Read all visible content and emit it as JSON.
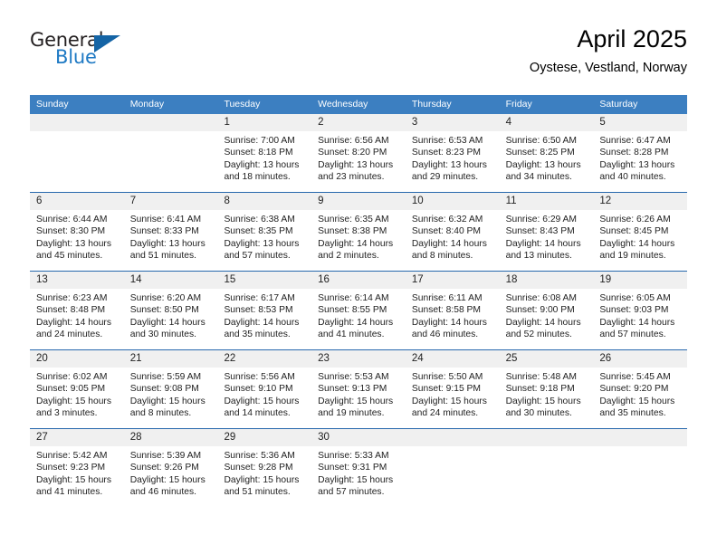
{
  "brand": {
    "name_part1": "General",
    "name_part2": "Blue",
    "accent_color": "#1464a5"
  },
  "header": {
    "title": "April 2025",
    "subtitle": "Oystese, Vestland, Norway"
  },
  "calendar": {
    "header_bg": "#3c7fc1",
    "row_rule_color": "#2768ad",
    "daynum_bg": "#f0f0f0",
    "weekdays": [
      "Sunday",
      "Monday",
      "Tuesday",
      "Wednesday",
      "Thursday",
      "Friday",
      "Saturday"
    ],
    "weeks": [
      [
        {
          "day": "",
          "lines": []
        },
        {
          "day": "",
          "lines": []
        },
        {
          "day": "1",
          "lines": [
            "Sunrise: 7:00 AM",
            "Sunset: 8:18 PM",
            "Daylight: 13 hours",
            "and 18 minutes."
          ]
        },
        {
          "day": "2",
          "lines": [
            "Sunrise: 6:56 AM",
            "Sunset: 8:20 PM",
            "Daylight: 13 hours",
            "and 23 minutes."
          ]
        },
        {
          "day": "3",
          "lines": [
            "Sunrise: 6:53 AM",
            "Sunset: 8:23 PM",
            "Daylight: 13 hours",
            "and 29 minutes."
          ]
        },
        {
          "day": "4",
          "lines": [
            "Sunrise: 6:50 AM",
            "Sunset: 8:25 PM",
            "Daylight: 13 hours",
            "and 34 minutes."
          ]
        },
        {
          "day": "5",
          "lines": [
            "Sunrise: 6:47 AM",
            "Sunset: 8:28 PM",
            "Daylight: 13 hours",
            "and 40 minutes."
          ]
        }
      ],
      [
        {
          "day": "6",
          "lines": [
            "Sunrise: 6:44 AM",
            "Sunset: 8:30 PM",
            "Daylight: 13 hours",
            "and 45 minutes."
          ]
        },
        {
          "day": "7",
          "lines": [
            "Sunrise: 6:41 AM",
            "Sunset: 8:33 PM",
            "Daylight: 13 hours",
            "and 51 minutes."
          ]
        },
        {
          "day": "8",
          "lines": [
            "Sunrise: 6:38 AM",
            "Sunset: 8:35 PM",
            "Daylight: 13 hours",
            "and 57 minutes."
          ]
        },
        {
          "day": "9",
          "lines": [
            "Sunrise: 6:35 AM",
            "Sunset: 8:38 PM",
            "Daylight: 14 hours",
            "and 2 minutes."
          ]
        },
        {
          "day": "10",
          "lines": [
            "Sunrise: 6:32 AM",
            "Sunset: 8:40 PM",
            "Daylight: 14 hours",
            "and 8 minutes."
          ]
        },
        {
          "day": "11",
          "lines": [
            "Sunrise: 6:29 AM",
            "Sunset: 8:43 PM",
            "Daylight: 14 hours",
            "and 13 minutes."
          ]
        },
        {
          "day": "12",
          "lines": [
            "Sunrise: 6:26 AM",
            "Sunset: 8:45 PM",
            "Daylight: 14 hours",
            "and 19 minutes."
          ]
        }
      ],
      [
        {
          "day": "13",
          "lines": [
            "Sunrise: 6:23 AM",
            "Sunset: 8:48 PM",
            "Daylight: 14 hours",
            "and 24 minutes."
          ]
        },
        {
          "day": "14",
          "lines": [
            "Sunrise: 6:20 AM",
            "Sunset: 8:50 PM",
            "Daylight: 14 hours",
            "and 30 minutes."
          ]
        },
        {
          "day": "15",
          "lines": [
            "Sunrise: 6:17 AM",
            "Sunset: 8:53 PM",
            "Daylight: 14 hours",
            "and 35 minutes."
          ]
        },
        {
          "day": "16",
          "lines": [
            "Sunrise: 6:14 AM",
            "Sunset: 8:55 PM",
            "Daylight: 14 hours",
            "and 41 minutes."
          ]
        },
        {
          "day": "17",
          "lines": [
            "Sunrise: 6:11 AM",
            "Sunset: 8:58 PM",
            "Daylight: 14 hours",
            "and 46 minutes."
          ]
        },
        {
          "day": "18",
          "lines": [
            "Sunrise: 6:08 AM",
            "Sunset: 9:00 PM",
            "Daylight: 14 hours",
            "and 52 minutes."
          ]
        },
        {
          "day": "19",
          "lines": [
            "Sunrise: 6:05 AM",
            "Sunset: 9:03 PM",
            "Daylight: 14 hours",
            "and 57 minutes."
          ]
        }
      ],
      [
        {
          "day": "20",
          "lines": [
            "Sunrise: 6:02 AM",
            "Sunset: 9:05 PM",
            "Daylight: 15 hours",
            "and 3 minutes."
          ]
        },
        {
          "day": "21",
          "lines": [
            "Sunrise: 5:59 AM",
            "Sunset: 9:08 PM",
            "Daylight: 15 hours",
            "and 8 minutes."
          ]
        },
        {
          "day": "22",
          "lines": [
            "Sunrise: 5:56 AM",
            "Sunset: 9:10 PM",
            "Daylight: 15 hours",
            "and 14 minutes."
          ]
        },
        {
          "day": "23",
          "lines": [
            "Sunrise: 5:53 AM",
            "Sunset: 9:13 PM",
            "Daylight: 15 hours",
            "and 19 minutes."
          ]
        },
        {
          "day": "24",
          "lines": [
            "Sunrise: 5:50 AM",
            "Sunset: 9:15 PM",
            "Daylight: 15 hours",
            "and 24 minutes."
          ]
        },
        {
          "day": "25",
          "lines": [
            "Sunrise: 5:48 AM",
            "Sunset: 9:18 PM",
            "Daylight: 15 hours",
            "and 30 minutes."
          ]
        },
        {
          "day": "26",
          "lines": [
            "Sunrise: 5:45 AM",
            "Sunset: 9:20 PM",
            "Daylight: 15 hours",
            "and 35 minutes."
          ]
        }
      ],
      [
        {
          "day": "27",
          "lines": [
            "Sunrise: 5:42 AM",
            "Sunset: 9:23 PM",
            "Daylight: 15 hours",
            "and 41 minutes."
          ]
        },
        {
          "day": "28",
          "lines": [
            "Sunrise: 5:39 AM",
            "Sunset: 9:26 PM",
            "Daylight: 15 hours",
            "and 46 minutes."
          ]
        },
        {
          "day": "29",
          "lines": [
            "Sunrise: 5:36 AM",
            "Sunset: 9:28 PM",
            "Daylight: 15 hours",
            "and 51 minutes."
          ]
        },
        {
          "day": "30",
          "lines": [
            "Sunrise: 5:33 AM",
            "Sunset: 9:31 PM",
            "Daylight: 15 hours",
            "and 57 minutes."
          ]
        },
        {
          "day": "",
          "lines": []
        },
        {
          "day": "",
          "lines": []
        },
        {
          "day": "",
          "lines": []
        }
      ]
    ]
  }
}
